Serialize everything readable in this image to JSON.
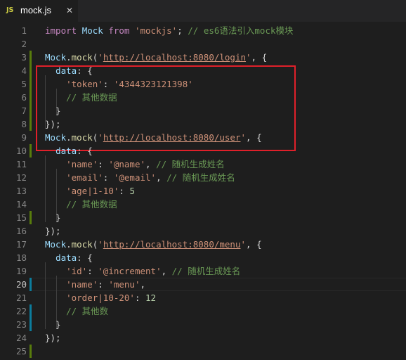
{
  "tab": {
    "icon_text": "JS",
    "file_name": "mock.js",
    "close_glyph": "✕"
  },
  "editor": {
    "active_line": 20,
    "line_numbers": [
      "1",
      "2",
      "3",
      "4",
      "5",
      "6",
      "7",
      "8",
      "9",
      "10",
      "11",
      "12",
      "13",
      "14",
      "15",
      "16",
      "17",
      "18",
      "19",
      "20",
      "21",
      "22",
      "23",
      "24",
      "25"
    ],
    "lines": [
      [
        [
          "k",
          "import"
        ],
        [
          "p",
          " "
        ],
        [
          "i",
          "Mock"
        ],
        [
          "p",
          " "
        ],
        [
          "k",
          "from"
        ],
        [
          "p",
          " "
        ],
        [
          "s",
          "'mockjs'"
        ],
        [
          "p",
          "; "
        ],
        [
          "c",
          "// es6语法引入mock模块"
        ]
      ],
      [],
      [
        [
          "i",
          "Mock"
        ],
        [
          "p",
          "."
        ],
        [
          "f",
          "mock"
        ],
        [
          "p",
          "("
        ],
        [
          "s",
          "'"
        ],
        [
          "u",
          "http://localhost:8080/login"
        ],
        [
          "s",
          "'"
        ],
        [
          "p",
          ", {"
        ]
      ],
      [
        [
          "p",
          "  "
        ],
        [
          "i",
          "data"
        ],
        [
          "p",
          ": {"
        ]
      ],
      [
        [
          "p",
          "    "
        ],
        [
          "s",
          "'token'"
        ],
        [
          "p",
          ": "
        ],
        [
          "s",
          "'4344323121398'"
        ]
      ],
      [
        [
          "p",
          "    "
        ],
        [
          "c",
          "// 其他数据"
        ]
      ],
      [
        [
          "p",
          "  }"
        ]
      ],
      [
        [
          "p",
          "});"
        ]
      ],
      [
        [
          "i",
          "Mock"
        ],
        [
          "p",
          "."
        ],
        [
          "f",
          "mock"
        ],
        [
          "p",
          "("
        ],
        [
          "s",
          "'"
        ],
        [
          "u",
          "http://localhost:8080/user"
        ],
        [
          "s",
          "'"
        ],
        [
          "p",
          ", {"
        ]
      ],
      [
        [
          "p",
          "  "
        ],
        [
          "i",
          "data"
        ],
        [
          "p",
          ": {"
        ]
      ],
      [
        [
          "p",
          "    "
        ],
        [
          "s",
          "'name'"
        ],
        [
          "p",
          ": "
        ],
        [
          "s",
          "'@name'"
        ],
        [
          "p",
          ", "
        ],
        [
          "c",
          "// 随机生成姓名"
        ]
      ],
      [
        [
          "p",
          "    "
        ],
        [
          "s",
          "'email'"
        ],
        [
          "p",
          ": "
        ],
        [
          "s",
          "'@email'"
        ],
        [
          "p",
          ", "
        ],
        [
          "c",
          "// 随机生成姓名"
        ]
      ],
      [
        [
          "p",
          "    "
        ],
        [
          "s",
          "'age|1-10'"
        ],
        [
          "p",
          ": "
        ],
        [
          "n",
          "5"
        ]
      ],
      [
        [
          "p",
          "    "
        ],
        [
          "c",
          "// 其他数据"
        ]
      ],
      [
        [
          "p",
          "  }"
        ]
      ],
      [
        [
          "p",
          "});"
        ]
      ],
      [
        [
          "i",
          "Mock"
        ],
        [
          "p",
          "."
        ],
        [
          "f",
          "mock"
        ],
        [
          "p",
          "("
        ],
        [
          "s",
          "'"
        ],
        [
          "u",
          "http://localhost:8080/menu"
        ],
        [
          "s",
          "'"
        ],
        [
          "p",
          ", {"
        ]
      ],
      [
        [
          "p",
          "  "
        ],
        [
          "i",
          "data"
        ],
        [
          "p",
          ": {"
        ]
      ],
      [
        [
          "p",
          "    "
        ],
        [
          "s",
          "'id'"
        ],
        [
          "p",
          ": "
        ],
        [
          "s",
          "'@increment'"
        ],
        [
          "p",
          ", "
        ],
        [
          "c",
          "// 随机生成姓名"
        ]
      ],
      [
        [
          "p",
          "    "
        ],
        [
          "s",
          "'name'"
        ],
        [
          "p",
          ": "
        ],
        [
          "s",
          "'menu'"
        ],
        [
          "p",
          ","
        ]
      ],
      [
        [
          "p",
          "    "
        ],
        [
          "s",
          "'order|10-20'"
        ],
        [
          "p",
          ": "
        ],
        [
          "n",
          "12"
        ]
      ],
      [
        [
          "p",
          "    "
        ],
        [
          "c",
          "// 其他数"
        ]
      ],
      [
        [
          "p",
          "  }"
        ]
      ],
      [
        [
          "p",
          "});"
        ]
      ],
      []
    ],
    "gutter_marks": {
      "3": "added",
      "4": "added",
      "5": "added",
      "6": "added",
      "7": "added",
      "8": "added",
      "10": "added",
      "15": "added",
      "20": "modified",
      "22": "modified",
      "23": "modified",
      "25": "added"
    },
    "colors": {
      "background": "#1e1e1e",
      "keyword": "#c586c0",
      "identifier": "#9cdcfe",
      "function": "#dcdcaa",
      "string": "#ce9178",
      "number": "#b5cea8",
      "comment": "#6a9955",
      "highlight_box": "#e0202a"
    }
  }
}
